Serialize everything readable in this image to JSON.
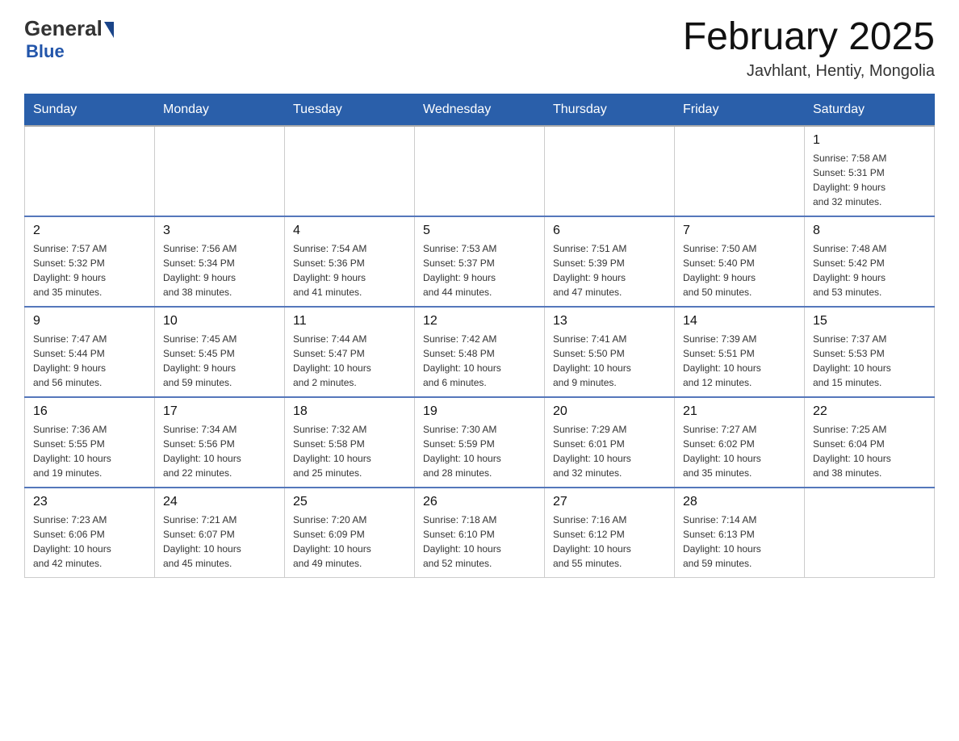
{
  "header": {
    "logo_general": "General",
    "logo_blue": "Blue",
    "title": "February 2025",
    "subtitle": "Javhlant, Hentiy, Mongolia"
  },
  "days_of_week": [
    "Sunday",
    "Monday",
    "Tuesday",
    "Wednesday",
    "Thursday",
    "Friday",
    "Saturday"
  ],
  "weeks": [
    [
      {
        "day": "",
        "info": ""
      },
      {
        "day": "",
        "info": ""
      },
      {
        "day": "",
        "info": ""
      },
      {
        "day": "",
        "info": ""
      },
      {
        "day": "",
        "info": ""
      },
      {
        "day": "",
        "info": ""
      },
      {
        "day": "1",
        "info": "Sunrise: 7:58 AM\nSunset: 5:31 PM\nDaylight: 9 hours\nand 32 minutes."
      }
    ],
    [
      {
        "day": "2",
        "info": "Sunrise: 7:57 AM\nSunset: 5:32 PM\nDaylight: 9 hours\nand 35 minutes."
      },
      {
        "day": "3",
        "info": "Sunrise: 7:56 AM\nSunset: 5:34 PM\nDaylight: 9 hours\nand 38 minutes."
      },
      {
        "day": "4",
        "info": "Sunrise: 7:54 AM\nSunset: 5:36 PM\nDaylight: 9 hours\nand 41 minutes."
      },
      {
        "day": "5",
        "info": "Sunrise: 7:53 AM\nSunset: 5:37 PM\nDaylight: 9 hours\nand 44 minutes."
      },
      {
        "day": "6",
        "info": "Sunrise: 7:51 AM\nSunset: 5:39 PM\nDaylight: 9 hours\nand 47 minutes."
      },
      {
        "day": "7",
        "info": "Sunrise: 7:50 AM\nSunset: 5:40 PM\nDaylight: 9 hours\nand 50 minutes."
      },
      {
        "day": "8",
        "info": "Sunrise: 7:48 AM\nSunset: 5:42 PM\nDaylight: 9 hours\nand 53 minutes."
      }
    ],
    [
      {
        "day": "9",
        "info": "Sunrise: 7:47 AM\nSunset: 5:44 PM\nDaylight: 9 hours\nand 56 minutes."
      },
      {
        "day": "10",
        "info": "Sunrise: 7:45 AM\nSunset: 5:45 PM\nDaylight: 9 hours\nand 59 minutes."
      },
      {
        "day": "11",
        "info": "Sunrise: 7:44 AM\nSunset: 5:47 PM\nDaylight: 10 hours\nand 2 minutes."
      },
      {
        "day": "12",
        "info": "Sunrise: 7:42 AM\nSunset: 5:48 PM\nDaylight: 10 hours\nand 6 minutes."
      },
      {
        "day": "13",
        "info": "Sunrise: 7:41 AM\nSunset: 5:50 PM\nDaylight: 10 hours\nand 9 minutes."
      },
      {
        "day": "14",
        "info": "Sunrise: 7:39 AM\nSunset: 5:51 PM\nDaylight: 10 hours\nand 12 minutes."
      },
      {
        "day": "15",
        "info": "Sunrise: 7:37 AM\nSunset: 5:53 PM\nDaylight: 10 hours\nand 15 minutes."
      }
    ],
    [
      {
        "day": "16",
        "info": "Sunrise: 7:36 AM\nSunset: 5:55 PM\nDaylight: 10 hours\nand 19 minutes."
      },
      {
        "day": "17",
        "info": "Sunrise: 7:34 AM\nSunset: 5:56 PM\nDaylight: 10 hours\nand 22 minutes."
      },
      {
        "day": "18",
        "info": "Sunrise: 7:32 AM\nSunset: 5:58 PM\nDaylight: 10 hours\nand 25 minutes."
      },
      {
        "day": "19",
        "info": "Sunrise: 7:30 AM\nSunset: 5:59 PM\nDaylight: 10 hours\nand 28 minutes."
      },
      {
        "day": "20",
        "info": "Sunrise: 7:29 AM\nSunset: 6:01 PM\nDaylight: 10 hours\nand 32 minutes."
      },
      {
        "day": "21",
        "info": "Sunrise: 7:27 AM\nSunset: 6:02 PM\nDaylight: 10 hours\nand 35 minutes."
      },
      {
        "day": "22",
        "info": "Sunrise: 7:25 AM\nSunset: 6:04 PM\nDaylight: 10 hours\nand 38 minutes."
      }
    ],
    [
      {
        "day": "23",
        "info": "Sunrise: 7:23 AM\nSunset: 6:06 PM\nDaylight: 10 hours\nand 42 minutes."
      },
      {
        "day": "24",
        "info": "Sunrise: 7:21 AM\nSunset: 6:07 PM\nDaylight: 10 hours\nand 45 minutes."
      },
      {
        "day": "25",
        "info": "Sunrise: 7:20 AM\nSunset: 6:09 PM\nDaylight: 10 hours\nand 49 minutes."
      },
      {
        "day": "26",
        "info": "Sunrise: 7:18 AM\nSunset: 6:10 PM\nDaylight: 10 hours\nand 52 minutes."
      },
      {
        "day": "27",
        "info": "Sunrise: 7:16 AM\nSunset: 6:12 PM\nDaylight: 10 hours\nand 55 minutes."
      },
      {
        "day": "28",
        "info": "Sunrise: 7:14 AM\nSunset: 6:13 PM\nDaylight: 10 hours\nand 59 minutes."
      },
      {
        "day": "",
        "info": ""
      }
    ]
  ]
}
